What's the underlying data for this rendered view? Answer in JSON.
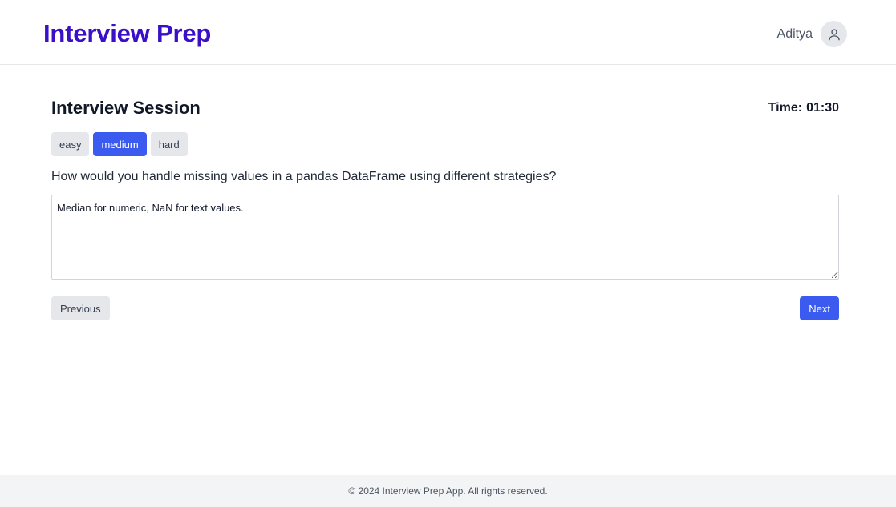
{
  "header": {
    "app_title": "Interview Prep",
    "user_name": "Aditya",
    "avatar_icon": "user-icon"
  },
  "session": {
    "title": "Interview Session",
    "timer_label": "Time:",
    "timer_value": "01:30",
    "difficulty_levels": [
      {
        "label": "easy",
        "selected": false
      },
      {
        "label": "medium",
        "selected": true
      },
      {
        "label": "hard",
        "selected": false
      }
    ],
    "question": "How would you handle missing values in a pandas DataFrame using different strategies?",
    "answer": "Median for numeric, NaN for text values.",
    "previous_label": "Previous",
    "next_label": "Next"
  },
  "footer": {
    "text": "© 2024 Interview Prep App. All rights reserved."
  },
  "colors": {
    "brand": "#3b0fc7",
    "accent": "#3b5bf0",
    "neutral_button": "#e5e7eb",
    "footer_bg": "#f3f4f6"
  }
}
